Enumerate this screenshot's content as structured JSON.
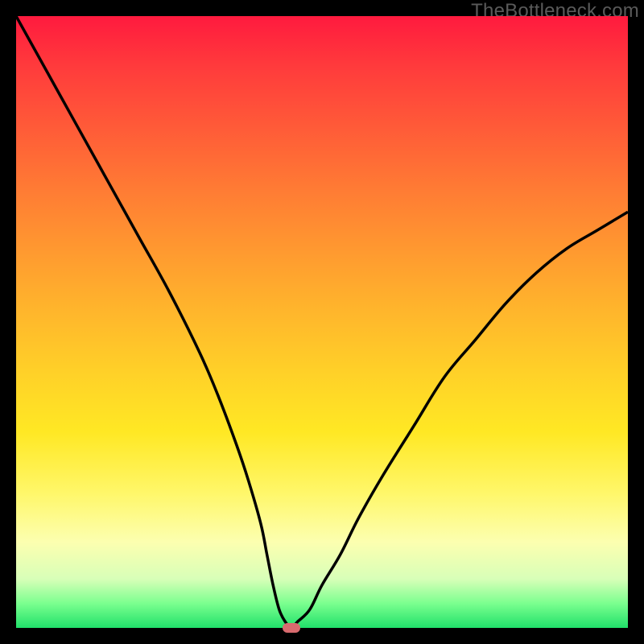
{
  "watermark": "TheBottleneck.com",
  "colors": {
    "curve": "#000000",
    "marker": "#d86a6e",
    "frame": "#000000"
  },
  "chart_data": {
    "type": "line",
    "title": "",
    "xlabel": "",
    "ylabel": "",
    "xlim": [
      0,
      100
    ],
    "ylim": [
      0,
      100
    ],
    "grid": false,
    "legend": false,
    "background": "rainbow-gradient-vertical",
    "series": [
      {
        "name": "bottleneck-curve",
        "x": [
          0,
          5,
          10,
          15,
          20,
          25,
          30,
          33,
          36,
          38,
          40,
          41,
          42,
          43,
          44,
          45,
          46,
          48,
          50,
          53,
          56,
          60,
          65,
          70,
          75,
          80,
          85,
          90,
          95,
          100
        ],
        "y": [
          100,
          91,
          82,
          73,
          64,
          55,
          45,
          38,
          30,
          24,
          17,
          12,
          7,
          3,
          1,
          0,
          1,
          3,
          7,
          12,
          18,
          25,
          33,
          41,
          47,
          53,
          58,
          62,
          65,
          68
        ]
      }
    ],
    "marker": {
      "x": 45,
      "y": 0,
      "shape": "pill",
      "color": "#d86a6e"
    }
  }
}
